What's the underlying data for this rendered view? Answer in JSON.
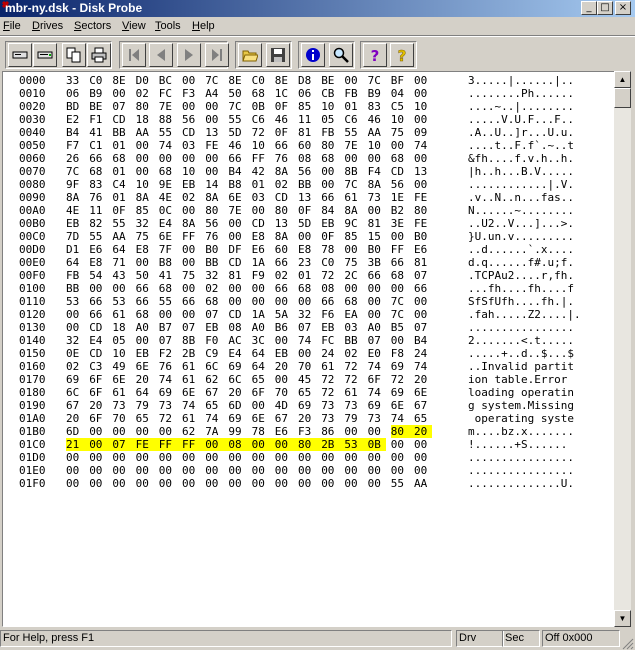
{
  "window": {
    "title": "mbr-ny.dsk - Disk Probe",
    "min_glyph": "_",
    "max_glyph": "□",
    "close_glyph": "×"
  },
  "menu": [
    {
      "label": "File",
      "u": "F"
    },
    {
      "label": "Drives",
      "u": "D"
    },
    {
      "label": "Sectors",
      "u": "S"
    },
    {
      "label": "View",
      "u": "V"
    },
    {
      "label": "Tools",
      "u": "T"
    },
    {
      "label": "Help",
      "u": "H"
    }
  ],
  "toolbar": [
    {
      "name": "read-drive-icon"
    },
    {
      "name": "drive-icon"
    },
    {
      "name": "copy-icon"
    },
    {
      "name": "print-icon"
    },
    {
      "name": "first-sector-icon"
    },
    {
      "name": "previous-sector-icon"
    },
    {
      "name": "next-sector-icon"
    },
    {
      "name": "last-sector-icon"
    },
    {
      "name": "open-folder-icon"
    },
    {
      "name": "save-icon"
    },
    {
      "name": "info-icon"
    },
    {
      "name": "search-icon"
    },
    {
      "name": "help-icon"
    },
    {
      "name": "context-help-icon"
    }
  ],
  "colors": {
    "highlight": "#ffff00",
    "info": "#0000cc",
    "help": "#8000c0"
  },
  "hex_rows": [
    {
      "addr": "0000",
      "bytes": [
        "33",
        "C0",
        "8E",
        "D0",
        "BC",
        "00",
        "7C",
        "8E",
        "C0",
        "8E",
        "D8",
        "BE",
        "00",
        "7C",
        "BF",
        "00"
      ],
      "ascii": "3.....|......|.."
    },
    {
      "addr": "0010",
      "bytes": [
        "06",
        "B9",
        "00",
        "02",
        "FC",
        "F3",
        "A4",
        "50",
        "68",
        "1C",
        "06",
        "CB",
        "FB",
        "B9",
        "04",
        "00"
      ],
      "ascii": "........Ph......"
    },
    {
      "addr": "0020",
      "bytes": [
        "BD",
        "BE",
        "07",
        "80",
        "7E",
        "00",
        "00",
        "7C",
        "0B",
        "0F",
        "85",
        "10",
        "01",
        "83",
        "C5",
        "10"
      ],
      "ascii": "....~..|........"
    },
    {
      "addr": "0030",
      "bytes": [
        "E2",
        "F1",
        "CD",
        "18",
        "88",
        "56",
        "00",
        "55",
        "C6",
        "46",
        "11",
        "05",
        "C6",
        "46",
        "10",
        "00"
      ],
      "ascii": ".....V.U.F...F.."
    },
    {
      "addr": "0040",
      "bytes": [
        "B4",
        "41",
        "BB",
        "AA",
        "55",
        "CD",
        "13",
        "5D",
        "72",
        "0F",
        "81",
        "FB",
        "55",
        "AA",
        "75",
        "09"
      ],
      "ascii": ".A..U..]r...U.u."
    },
    {
      "addr": "0050",
      "bytes": [
        "F7",
        "C1",
        "01",
        "00",
        "74",
        "03",
        "FE",
        "46",
        "10",
        "66",
        "60",
        "80",
        "7E",
        "10",
        "00",
        "74"
      ],
      "ascii": "....t..F.f`.~..t"
    },
    {
      "addr": "0060",
      "bytes": [
        "26",
        "66",
        "68",
        "00",
        "00",
        "00",
        "00",
        "66",
        "FF",
        "76",
        "08",
        "68",
        "00",
        "00",
        "68",
        "00"
      ],
      "ascii": "&fh....f.v.h..h."
    },
    {
      "addr": "0070",
      "bytes": [
        "7C",
        "68",
        "01",
        "00",
        "68",
        "10",
        "00",
        "B4",
        "42",
        "8A",
        "56",
        "00",
        "8B",
        "F4",
        "CD",
        "13"
      ],
      "ascii": "|h..h...B.V....."
    },
    {
      "addr": "0080",
      "bytes": [
        "9F",
        "83",
        "C4",
        "10",
        "9E",
        "EB",
        "14",
        "B8",
        "01",
        "02",
        "BB",
        "00",
        "7C",
        "8A",
        "56",
        "00"
      ],
      "ascii": "............|.V."
    },
    {
      "addr": "0090",
      "bytes": [
        "8A",
        "76",
        "01",
        "8A",
        "4E",
        "02",
        "8A",
        "6E",
        "03",
        "CD",
        "13",
        "66",
        "61",
        "73",
        "1E",
        "FE"
      ],
      "ascii": ".v..N..n...fas.."
    },
    {
      "addr": "00A0",
      "bytes": [
        "4E",
        "11",
        "0F",
        "85",
        "0C",
        "00",
        "80",
        "7E",
        "00",
        "80",
        "0F",
        "84",
        "8A",
        "00",
        "B2",
        "80"
      ],
      "ascii": "N......~........"
    },
    {
      "addr": "00B0",
      "bytes": [
        "EB",
        "82",
        "55",
        "32",
        "E4",
        "8A",
        "56",
        "00",
        "CD",
        "13",
        "5D",
        "EB",
        "9C",
        "81",
        "3E",
        "FE"
      ],
      "ascii": "..U2..V...]...>."
    },
    {
      "addr": "00C0",
      "bytes": [
        "7D",
        "55",
        "AA",
        "75",
        "6E",
        "FF",
        "76",
        "00",
        "E8",
        "8A",
        "00",
        "0F",
        "85",
        "15",
        "00",
        "B0"
      ],
      "ascii": "}U.un.v........."
    },
    {
      "addr": "00D0",
      "bytes": [
        "D1",
        "E6",
        "64",
        "E8",
        "7F",
        "00",
        "B0",
        "DF",
        "E6",
        "60",
        "E8",
        "78",
        "00",
        "B0",
        "FF",
        "E6"
      ],
      "ascii": "..d......`.x...."
    },
    {
      "addr": "00E0",
      "bytes": [
        "64",
        "E8",
        "71",
        "00",
        "B8",
        "00",
        "BB",
        "CD",
        "1A",
        "66",
        "23",
        "C0",
        "75",
        "3B",
        "66",
        "81"
      ],
      "ascii": "d.q......f#.u;f."
    },
    {
      "addr": "00F0",
      "bytes": [
        "FB",
        "54",
        "43",
        "50",
        "41",
        "75",
        "32",
        "81",
        "F9",
        "02",
        "01",
        "72",
        "2C",
        "66",
        "68",
        "07"
      ],
      "ascii": ".TCPAu2....r,fh."
    },
    {
      "addr": "0100",
      "bytes": [
        "BB",
        "00",
        "00",
        "66",
        "68",
        "00",
        "02",
        "00",
        "00",
        "66",
        "68",
        "08",
        "00",
        "00",
        "00",
        "66"
      ],
      "ascii": "...fh....fh....f"
    },
    {
      "addr": "0110",
      "bytes": [
        "53",
        "66",
        "53",
        "66",
        "55",
        "66",
        "68",
        "00",
        "00",
        "00",
        "00",
        "66",
        "68",
        "00",
        "7C",
        "00"
      ],
      "ascii": "SfSfUfh....fh.|."
    },
    {
      "addr": "0120",
      "bytes": [
        "00",
        "66",
        "61",
        "68",
        "00",
        "00",
        "07",
        "CD",
        "1A",
        "5A",
        "32",
        "F6",
        "EA",
        "00",
        "7C",
        "00"
      ],
      "ascii": ".fah.....Z2....|."
    },
    {
      "addr": "0130",
      "bytes": [
        "00",
        "CD",
        "18",
        "A0",
        "B7",
        "07",
        "EB",
        "08",
        "A0",
        "B6",
        "07",
        "EB",
        "03",
        "A0",
        "B5",
        "07"
      ],
      "ascii": "................"
    },
    {
      "addr": "0140",
      "bytes": [
        "32",
        "E4",
        "05",
        "00",
        "07",
        "8B",
        "F0",
        "AC",
        "3C",
        "00",
        "74",
        "FC",
        "BB",
        "07",
        "00",
        "B4"
      ],
      "ascii": "2.......<.t....."
    },
    {
      "addr": "0150",
      "bytes": [
        "0E",
        "CD",
        "10",
        "EB",
        "F2",
        "2B",
        "C9",
        "E4",
        "64",
        "EB",
        "00",
        "24",
        "02",
        "E0",
        "F8",
        "24"
      ],
      "ascii": ".....+..d..$...$"
    },
    {
      "addr": "0160",
      "bytes": [
        "02",
        "C3",
        "49",
        "6E",
        "76",
        "61",
        "6C",
        "69",
        "64",
        "20",
        "70",
        "61",
        "72",
        "74",
        "69",
        "74"
      ],
      "ascii": "..Invalid partit"
    },
    {
      "addr": "0170",
      "bytes": [
        "69",
        "6F",
        "6E",
        "20",
        "74",
        "61",
        "62",
        "6C",
        "65",
        "00",
        "45",
        "72",
        "72",
        "6F",
        "72",
        "20"
      ],
      "ascii": "ion table.Error "
    },
    {
      "addr": "0180",
      "bytes": [
        "6C",
        "6F",
        "61",
        "64",
        "69",
        "6E",
        "67",
        "20",
        "6F",
        "70",
        "65",
        "72",
        "61",
        "74",
        "69",
        "6E"
      ],
      "ascii": "loading operatin"
    },
    {
      "addr": "0190",
      "bytes": [
        "67",
        "20",
        "73",
        "79",
        "73",
        "74",
        "65",
        "6D",
        "00",
        "4D",
        "69",
        "73",
        "73",
        "69",
        "6E",
        "67"
      ],
      "ascii": "g system.Missing"
    },
    {
      "addr": "01A0",
      "bytes": [
        "20",
        "6F",
        "70",
        "65",
        "72",
        "61",
        "74",
        "69",
        "6E",
        "67",
        "20",
        "73",
        "79",
        "73",
        "74",
        "65"
      ],
      "ascii": " operating syste"
    },
    {
      "addr": "01B0",
      "bytes": [
        "6D",
        "00",
        "00",
        "00",
        "00",
        "62",
        "7A",
        "99",
        "78",
        "E6",
        "F3",
        "86",
        "00",
        "00",
        "80",
        "20"
      ],
      "ascii": "m....bz.x......."
    },
    {
      "addr": "01C0",
      "bytes": [
        "21",
        "00",
        "07",
        "FE",
        "FF",
        "FF",
        "00",
        "08",
        "00",
        "00",
        "80",
        "2B",
        "53",
        "0B",
        "00",
        "00"
      ],
      "ascii": "!......+S......"
    },
    {
      "addr": "01D0",
      "bytes": [
        "00",
        "00",
        "00",
        "00",
        "00",
        "00",
        "00",
        "00",
        "00",
        "00",
        "00",
        "00",
        "00",
        "00",
        "00",
        "00"
      ],
      "ascii": "................"
    },
    {
      "addr": "01E0",
      "bytes": [
        "00",
        "00",
        "00",
        "00",
        "00",
        "00",
        "00",
        "00",
        "00",
        "00",
        "00",
        "00",
        "00",
        "00",
        "00",
        "00"
      ],
      "ascii": "................"
    },
    {
      "addr": "01F0",
      "bytes": [
        "00",
        "00",
        "00",
        "00",
        "00",
        "00",
        "00",
        "00",
        "00",
        "00",
        "00",
        "00",
        "00",
        "00",
        "55",
        "AA"
      ],
      "ascii": "..............U."
    }
  ],
  "highlight": [
    {
      "row": 27,
      "from": 14,
      "to": 15
    },
    {
      "row": 28,
      "from": 0,
      "to": 13
    }
  ],
  "status": {
    "help": "For Help, press F1",
    "drive": "Drv",
    "sector": "Sec",
    "offset": "Off 0x000"
  }
}
